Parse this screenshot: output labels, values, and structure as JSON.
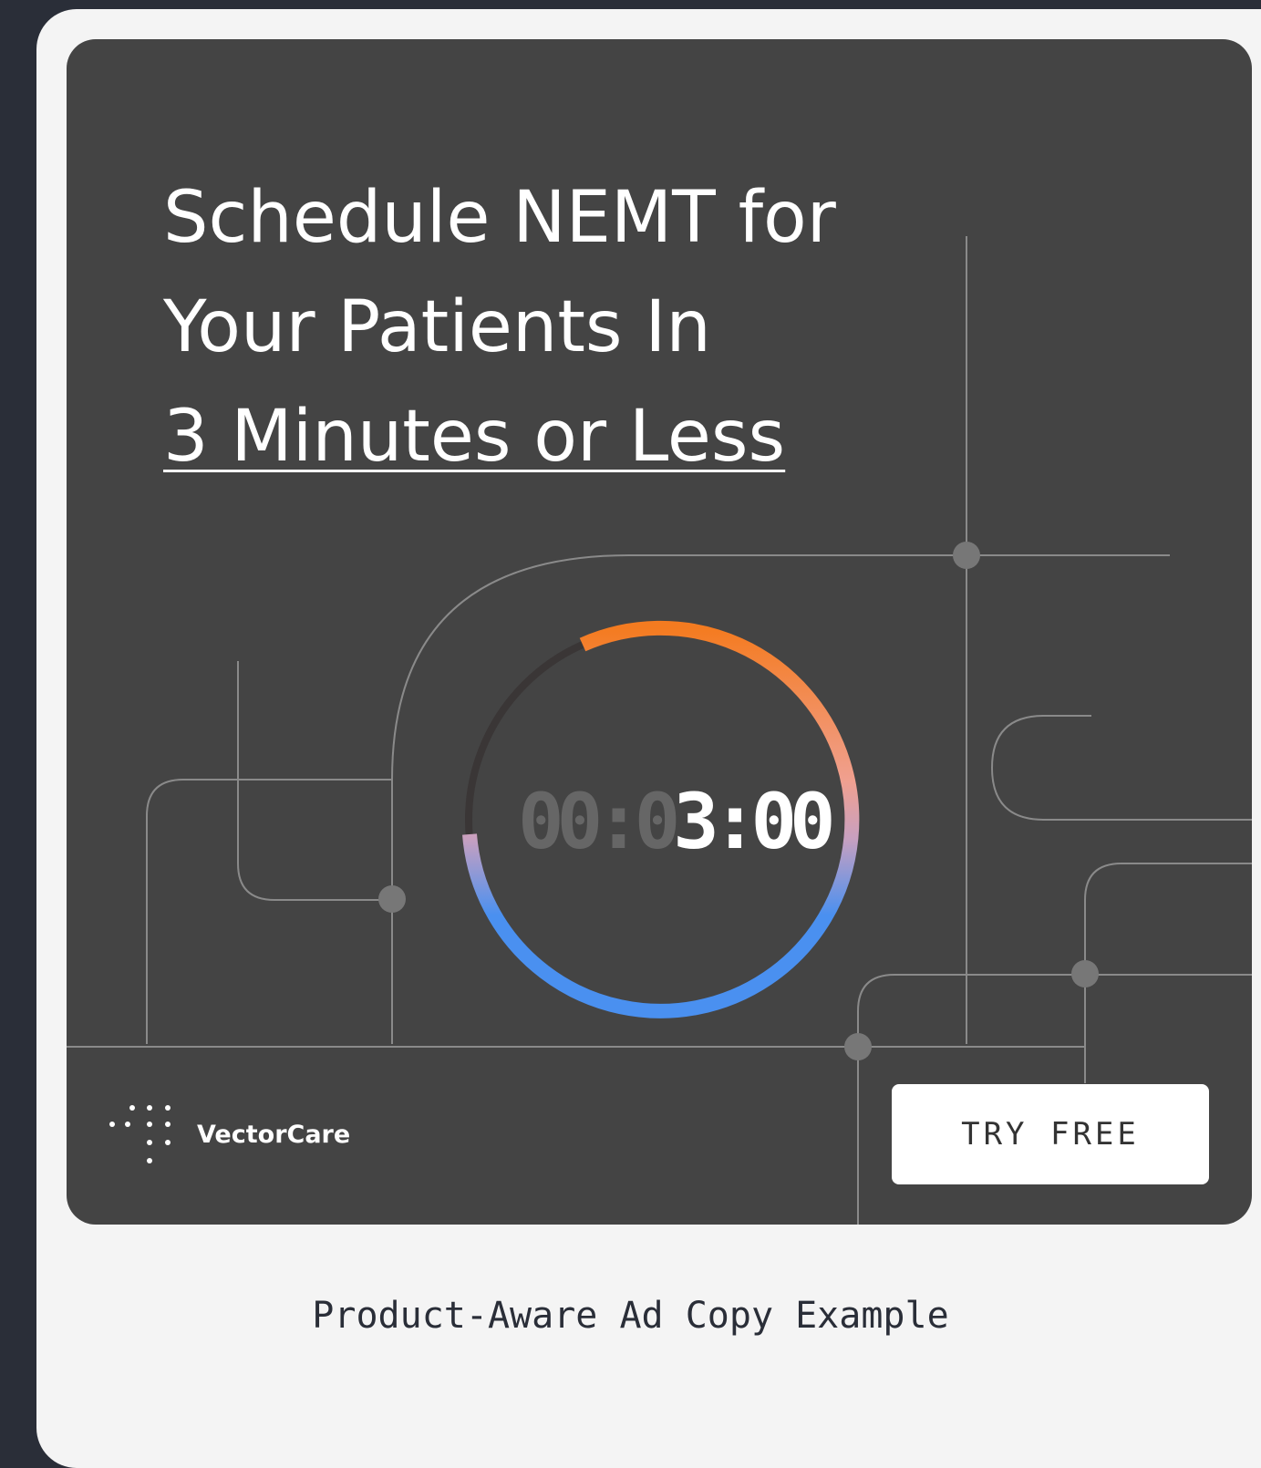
{
  "headline": {
    "line1": "Schedule NEMT for",
    "line2": "Your Patients In",
    "line3": "3 Minutes or Less"
  },
  "timer": {
    "dim_part": "00:0",
    "lit_part": "3:00"
  },
  "brand": {
    "name": "VectorCare"
  },
  "cta": {
    "label": "TRY FREE"
  },
  "caption": "Product-Aware Ad Copy Example",
  "colors": {
    "page_bg": "#2a2e38",
    "card_bg": "#f4f4f4",
    "ad_bg": "#444444",
    "ring_orange": "#f47b20",
    "ring_blue": "#4a90f0",
    "line_gray": "#8a8a8a"
  }
}
